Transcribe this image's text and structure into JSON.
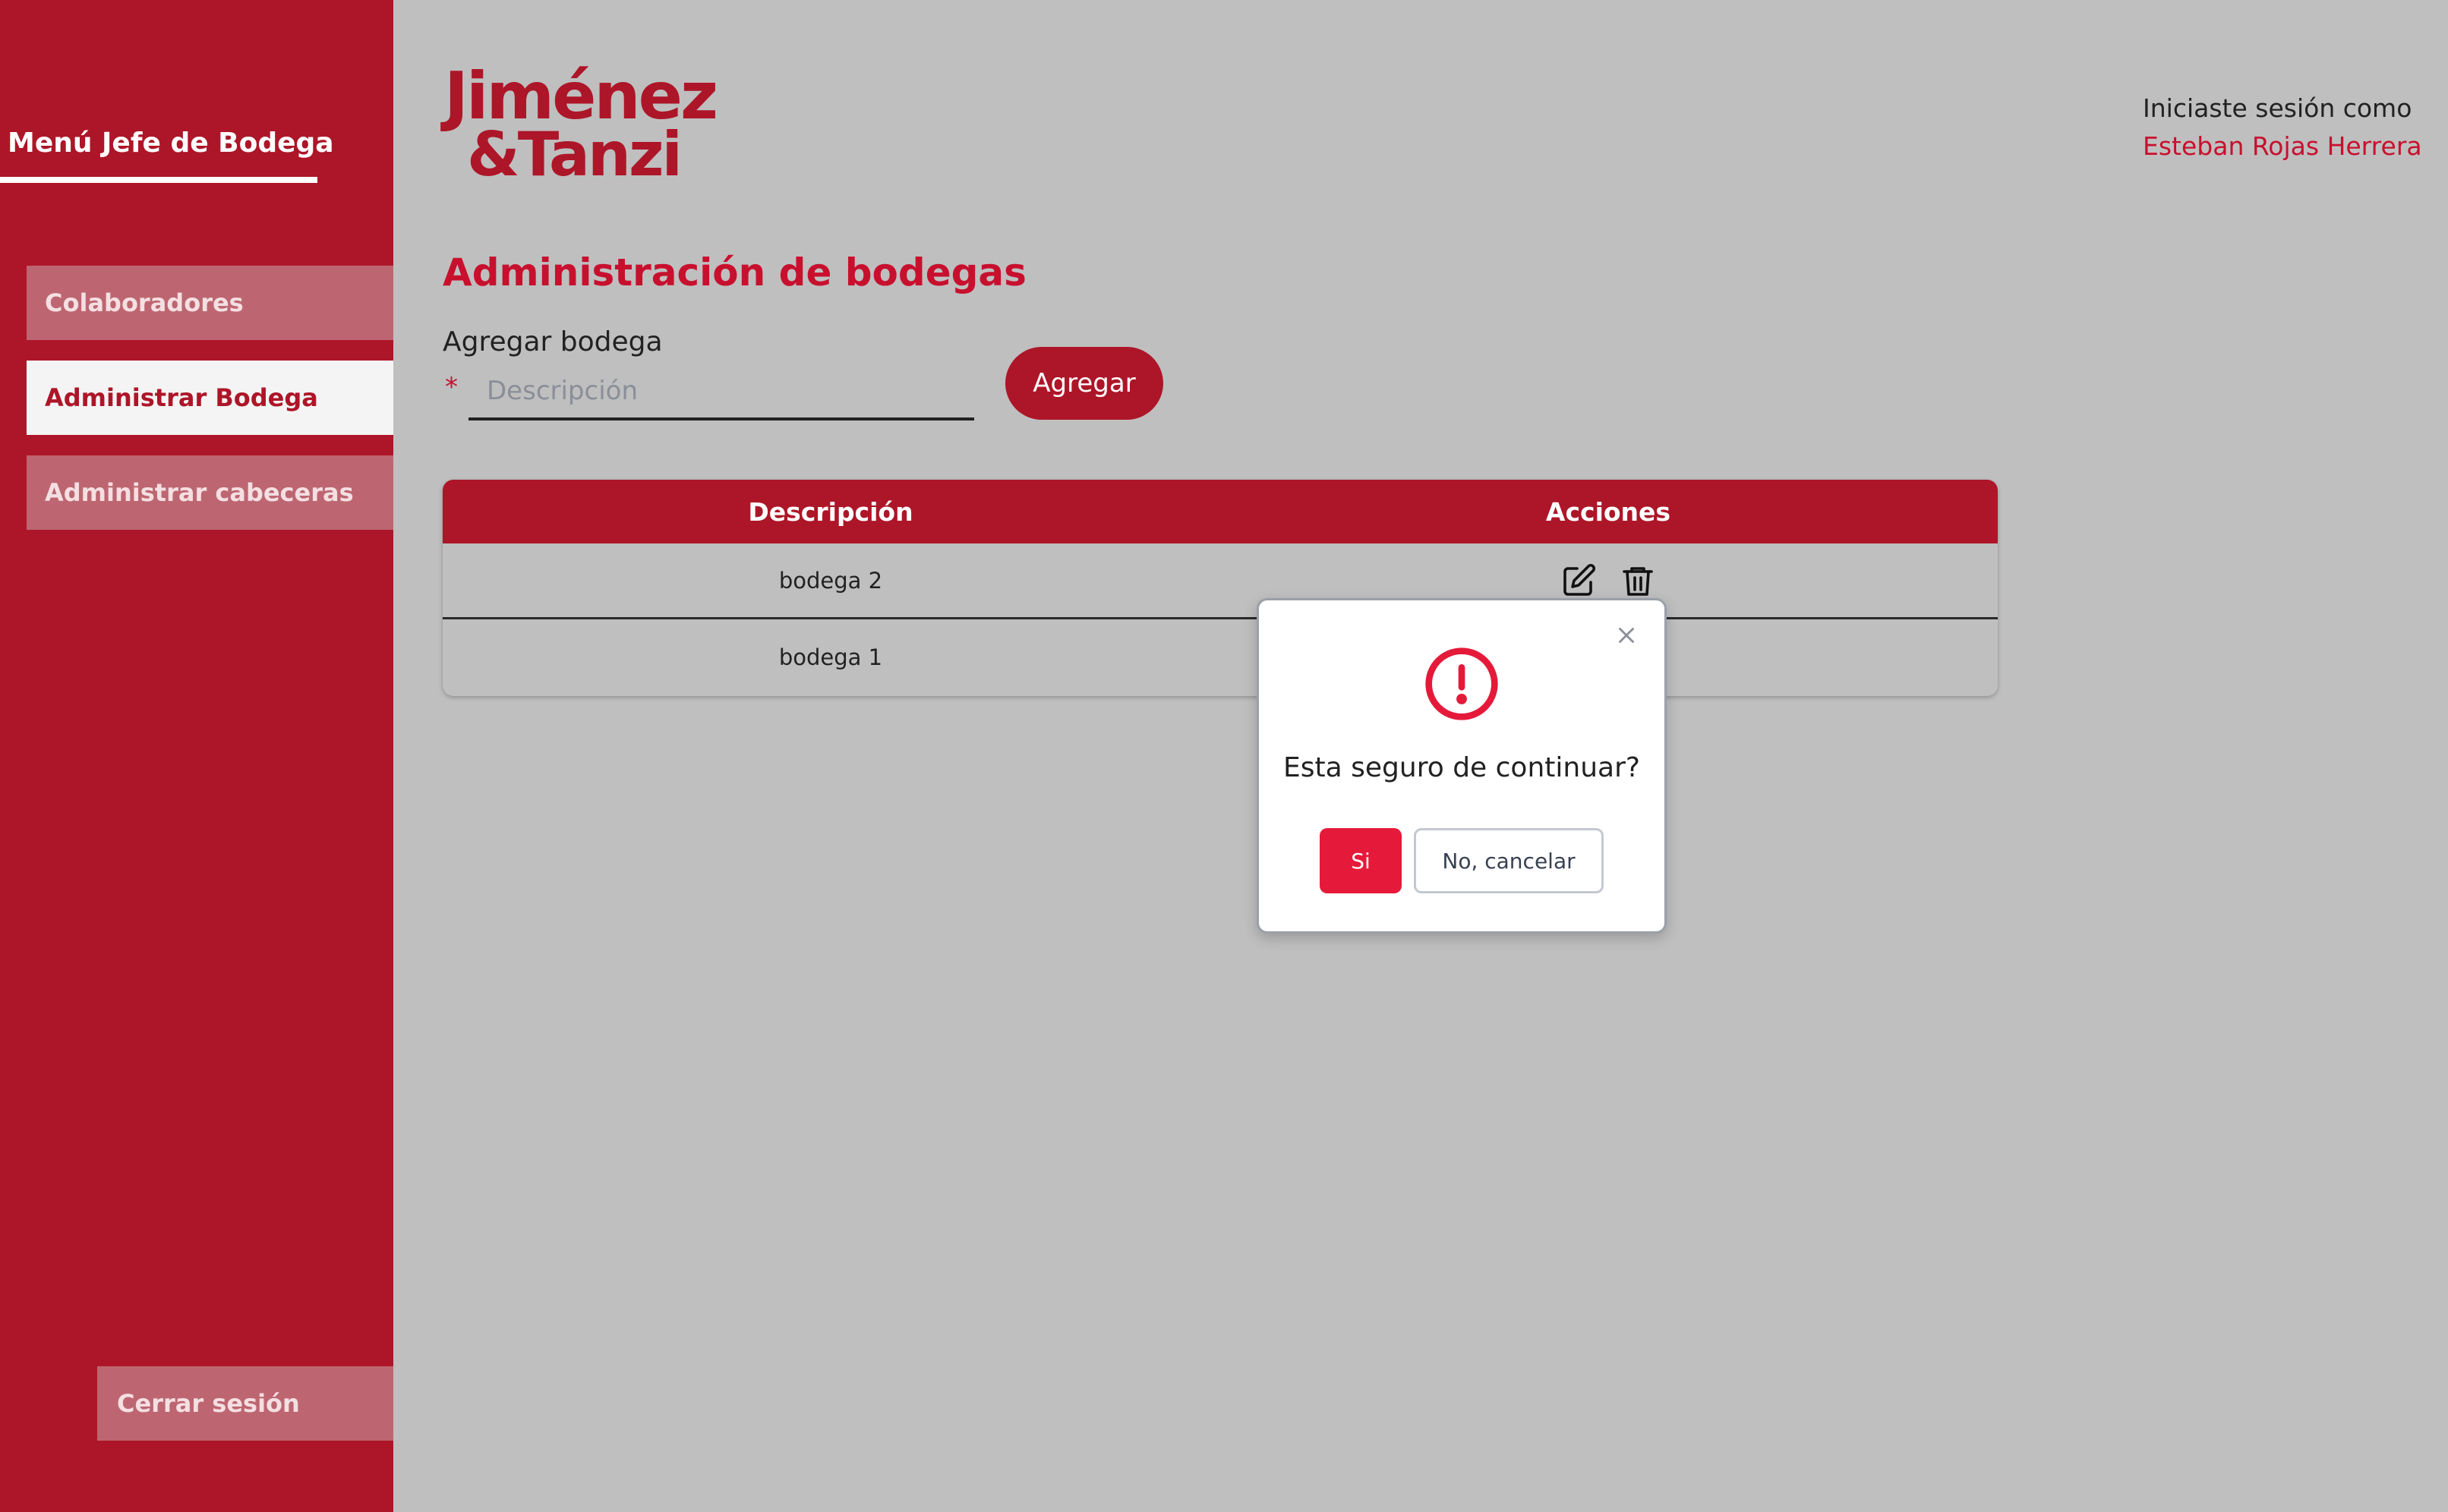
{
  "sidebar": {
    "title": "Menú Jefe de Bodega",
    "items": [
      {
        "label": "Colaboradores",
        "active": false
      },
      {
        "label": "Administrar Bodega",
        "active": true
      },
      {
        "label": "Administrar cabeceras",
        "active": false
      }
    ],
    "logout_label": "Cerrar sesión"
  },
  "header": {
    "logo_line1": "Jiménez",
    "logo_line2": "&Tanzi",
    "session_label": "Iniciaste sesión como",
    "user_name": "Esteban Rojas Herrera"
  },
  "main": {
    "title": "Administración de bodegas",
    "add_label": "Agregar bodega",
    "required_mark": "*",
    "input_placeholder": "Descripción",
    "input_value": "",
    "add_button": "Agregar"
  },
  "table": {
    "headers": [
      "Descripción",
      "Acciones"
    ],
    "rows": [
      {
        "description": "bodega 2"
      },
      {
        "description": "bodega 1"
      }
    ]
  },
  "modal": {
    "message": "Esta seguro de continuar?",
    "confirm_label": "Si",
    "cancel_label": "No, cancelar"
  },
  "colors": {
    "brand_red": "#ad1628",
    "accent_red": "#c8102e",
    "confirm_red": "#e51a3a",
    "overlay_gray": "#bfbfbf"
  },
  "icons": {
    "edit": "edit-icon",
    "delete": "trash-icon",
    "close": "close-icon",
    "alert": "alert-circle-icon"
  }
}
